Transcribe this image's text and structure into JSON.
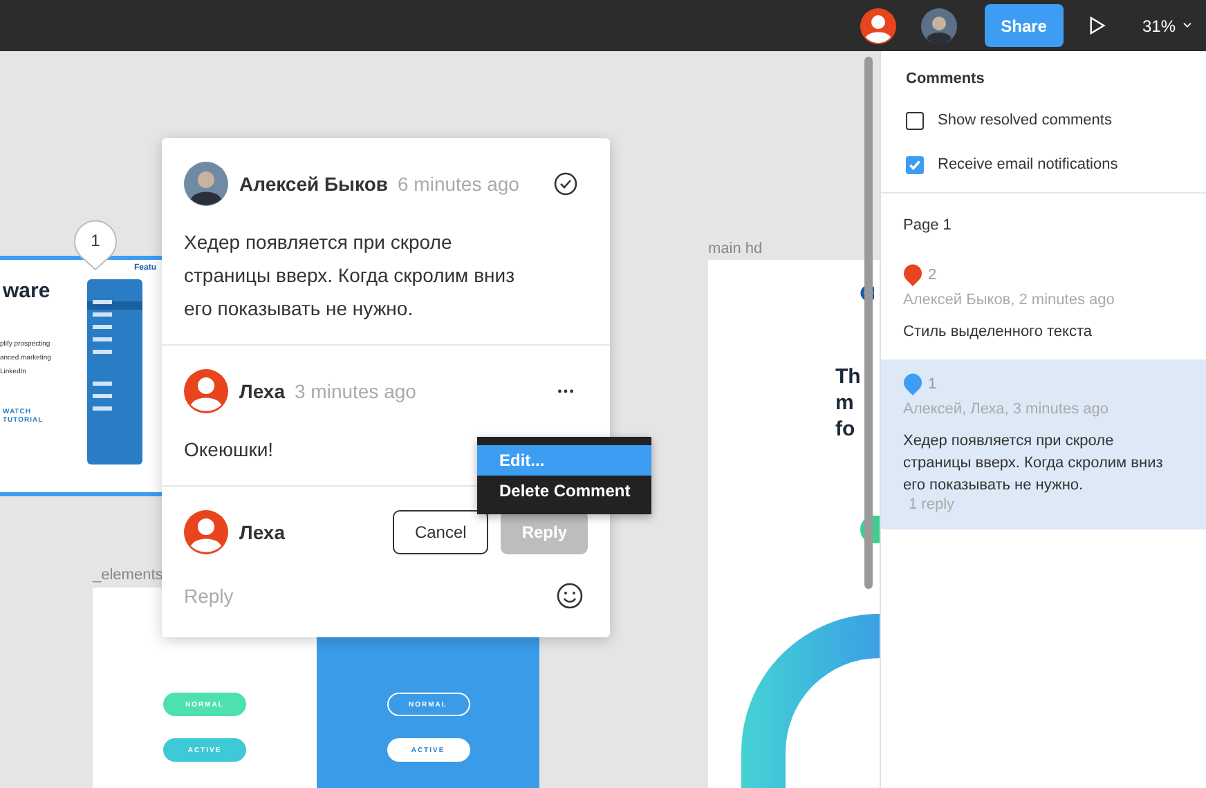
{
  "toolbar": {
    "share": "Share",
    "zoom": "31%"
  },
  "canvas": {
    "pin": "1",
    "frame_left": {
      "heading": "ware",
      "nav": "Featu",
      "lines": [
        "plify prospecting",
        "anced marketing",
        "LinkedIn"
      ],
      "link": "WATCH TUTORIAL"
    },
    "frame_main": {
      "label": "main hd",
      "heading": [
        "Th",
        "m",
        "fo"
      ]
    },
    "frame_elements": {
      "label": "_elements",
      "pills": [
        {
          "label": "NORMAL",
          "kind": "green"
        },
        {
          "label": "ACTIVE",
          "kind": "teal"
        },
        {
          "label": "NORMAL",
          "kind": "outline"
        },
        {
          "label": "ACTIVE",
          "kind": "white"
        }
      ]
    }
  },
  "popup": {
    "comments": [
      {
        "author": "Алексей Быков",
        "time": "6 minutes ago",
        "kind": "thread",
        "text": "Хедер появляется при скроле страницы вверх. Когда скролим вниз его показывать не нужно."
      },
      {
        "author": "Леха",
        "time": "3 minutes ago",
        "kind": "reply",
        "text": "Океюшки!"
      }
    ],
    "reply": {
      "author": "Леха",
      "cancel": "Cancel",
      "submit": "Reply",
      "submit_disabled": true,
      "placeholder": "Reply"
    }
  },
  "menu": {
    "items": [
      {
        "label": "Edit...",
        "selected": true
      },
      {
        "label": "Delete Comment",
        "selected": false
      }
    ]
  },
  "panel": {
    "title": "Comments",
    "options": [
      {
        "label": "Show resolved comments",
        "checked": false
      },
      {
        "label": "Receive email notifications",
        "checked": true
      }
    ],
    "page": "Page 1",
    "threads": [
      {
        "number": "2",
        "color": "#e8451f",
        "meta": "Алексей Быков, 2 minutes ago",
        "text": "Стиль выделенного текста",
        "selected": false
      },
      {
        "number": "1",
        "color": "#3d9df2",
        "meta": "Алексей, Леха, 3 minutes ago",
        "text": "Хедер появляется при скроле страницы вверх. Когда скролим вниз его показывать не нужно.",
        "replies": "1 reply",
        "selected": true
      }
    ]
  }
}
